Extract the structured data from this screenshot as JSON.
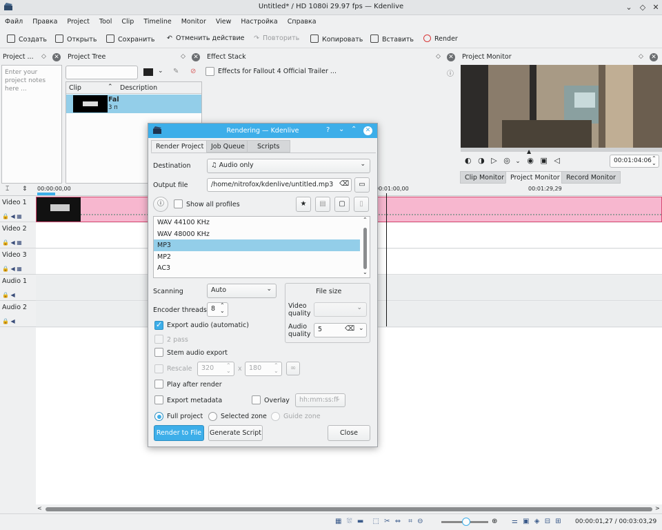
{
  "window": {
    "title": "Untitled* / HD 1080i 29.97 fps — Kdenlive",
    "icon": "kdenlive-logo-icon",
    "controls": [
      "chevron-down-icon",
      "diamond-icon",
      "close-icon"
    ]
  },
  "menu": [
    "Файл",
    "Правка",
    "Project",
    "Tool",
    "Clip",
    "Timeline",
    "Monitor",
    "View",
    "Настройка",
    "Справка"
  ],
  "toolbar": {
    "create": "Создать",
    "open": "Открыть",
    "save": "Сохранить",
    "undo": "Отменить действие",
    "redo": "Повторить",
    "copy": "Копировать",
    "paste": "Вставить",
    "render": "Render"
  },
  "project_notes": {
    "title": "Project ...",
    "placeholder": "Enter your project notes here ..."
  },
  "project_tree": {
    "title": "Project Tree",
    "columns": [
      "Clip",
      "Description"
    ],
    "clip": {
      "name": "Fal",
      "meta": "3 п"
    }
  },
  "effect_stack": {
    "title": "Effect Stack",
    "checkbox_label": "Effects for Fallout 4 Official Trailer ..."
  },
  "project_monitor": {
    "title": "Project Monitor",
    "timecode": "00:01:04:06",
    "tabs": [
      "Clip Monitor",
      "Project Monitor",
      "Record Monitor"
    ]
  },
  "timeline": {
    "ruler": [
      "00:00:00,00",
      "00:01:00,00",
      "00:01:29,29"
    ],
    "tracks": [
      "Video 1",
      "Video 2",
      "Video 3",
      "Audio 1",
      "Audio 2"
    ]
  },
  "status": {
    "timecode": "00:00:01,27 / 00:03:03,29"
  },
  "dialog": {
    "title": "Rendering — Kdenlive",
    "tabs": [
      "Render Project",
      "Job Queue",
      "Scripts"
    ],
    "destination_label": "Destination",
    "destination_value": "Audio only",
    "output_label": "Output file",
    "output_value": "/home/nitrofox/kdenlive/untitled.mp3",
    "show_all_profiles": "Show all profiles",
    "profiles": [
      "WAV 44100 KHz",
      "WAV 48000 KHz",
      "MP3",
      "MP2",
      "AC3"
    ],
    "selected_profile": "MP3",
    "scanning_label": "Scanning",
    "scanning_value": "Auto",
    "encoder_threads_label": "Encoder threads",
    "encoder_threads_value": "8",
    "file_size_label": "File size",
    "video_quality_label": "Video\nquality",
    "audio_quality_label": "Audio\nquality",
    "audio_quality_value": "5",
    "export_audio": "Export audio (automatic)",
    "two_pass": "2 pass",
    "stem_audio": "Stem audio export",
    "rescale": "Rescale",
    "rescale_w": "320",
    "rescale_x": "x",
    "rescale_h": "180",
    "play_after_render": "Play after render",
    "export_metadata": "Export metadata",
    "overlay": "Overlay",
    "overlay_value": "hh:mm:ss:ff",
    "full_project": "Full project",
    "selected_zone": "Selected zone",
    "guide_zone": "Guide zone",
    "render_to_file": "Render to File",
    "generate_script": "Generate Script",
    "close": "Close"
  }
}
